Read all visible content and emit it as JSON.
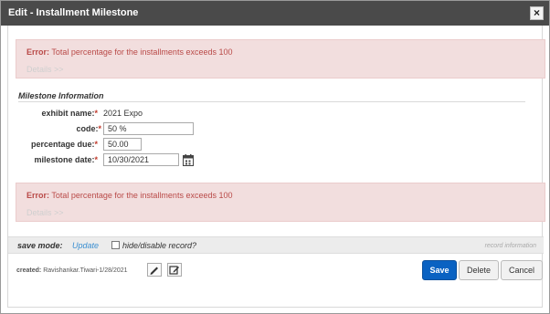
{
  "dialog": {
    "title": "Edit - Installment Milestone",
    "close_label": "×"
  },
  "errors": [
    {
      "prefix": "Error:",
      "message": "Total percentage for the installments exceeds 100",
      "details": "Details >>"
    },
    {
      "prefix": "Error:",
      "message": "Total percentage for the installments exceeds 100",
      "details": "Details >>"
    }
  ],
  "section": {
    "title": "Milestone Information"
  },
  "fields": {
    "exhibit_name": {
      "label": "exhibit name:",
      "required": "*",
      "value": "2021 Expo"
    },
    "code": {
      "label": "code:",
      "required": "*",
      "value": "50 %"
    },
    "percentage_due": {
      "label": "percentage due:",
      "required": "*",
      "value": "50.00"
    },
    "milestone_date": {
      "label": "milestone date:",
      "required": "*",
      "value": "10/30/2021"
    }
  },
  "save_bar": {
    "save_mode_label": "save mode:",
    "save_mode_value": "Update",
    "hide_label": "hide/disable record?",
    "hide_checked": false,
    "record_info": "record information"
  },
  "footer": {
    "created_label": "created:",
    "created_value": "Ravishankar.Tiwari-1/28/2021",
    "save_label": "Save",
    "delete_label": "Delete",
    "cancel_label": "Cancel"
  },
  "colors": {
    "title_bar": "#4a4a4a",
    "error_bg": "#f2dede",
    "error_text": "#b94a48",
    "primary_button": "#0a62c2",
    "link": "#3b8fd1"
  }
}
